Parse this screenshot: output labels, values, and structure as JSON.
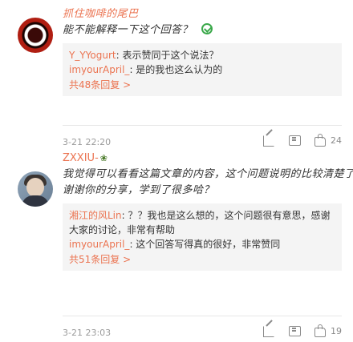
{
  "comments": [
    {
      "username": "抓住咖啡的尾巴",
      "text": "能不能解释一下这个回答？",
      "replies": [
        {
          "name": "Y_YYogurt",
          "text": "表示赞同于这个说法？"
        },
        {
          "name": "imyourApril_",
          "text": "是的我也这么认为的"
        }
      ],
      "more": "共48条回复 >",
      "time": "3-21 22:20",
      "likes": "24"
    },
    {
      "username": "ZXXIU-",
      "text_line1": "我觉得可以看看这篇文章的内容，这个问题说明的比较清楚了",
      "text_line2": "谢谢你的分享，学到了很多哈？",
      "replies": [
        {
          "name": "湘江的风Lin",
          "text": "？？我也是这么想的，这个问题很有意思，感谢大家的讨论，非常有帮助"
        },
        {
          "name": "imyourApril_",
          "text": "这个回答写得真的很好，非常赞同"
        }
      ],
      "more": "共51条回复 >",
      "time": "3-21 23:03",
      "likes": "19"
    }
  ]
}
